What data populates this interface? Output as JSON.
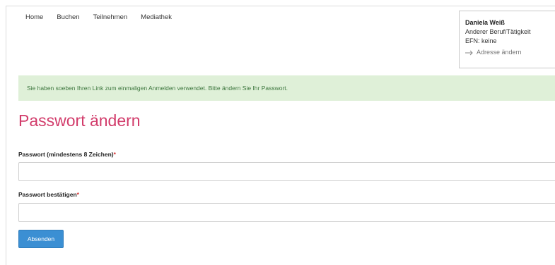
{
  "nav": {
    "items": [
      "Home",
      "Buchen",
      "Teilnehmen",
      "Mediathek"
    ]
  },
  "user": {
    "name": "Daniela Weiß",
    "profession": "Anderer Beruf/Tätigkeit",
    "efn": "EFN: keine",
    "change_address": "Adresse ändern"
  },
  "alert": {
    "message": "Sie haben soeben Ihren Link zum einmaligen Anmelden verwendet. Bitte ändern Sie Ihr Passwort."
  },
  "form": {
    "title": "Passwort ändern",
    "password_label": "Passwort (mindestens 8 Zeichen)",
    "confirm_label": "Passwort bestätigen",
    "required_mark": "*",
    "password_value": "",
    "confirm_value": "",
    "submit_label": "Absenden"
  },
  "colors": {
    "title": "#d23c6b",
    "alert_bg": "#dff0d8",
    "button": "#3b8fd3",
    "required": "#d32f2f"
  }
}
